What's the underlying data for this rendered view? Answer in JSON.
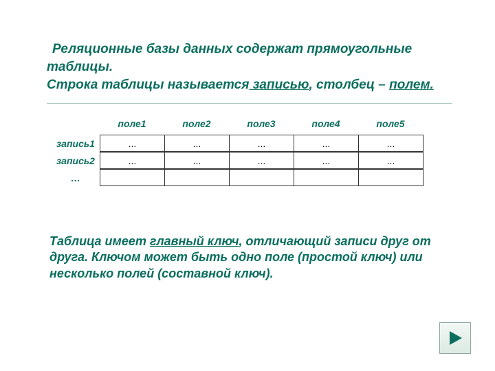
{
  "heading": {
    "line1_indent": "Реляционные базы данных содержат прямоугольные",
    "line2": "таблицы.",
    "line3_pre": "Строка таблицы называется",
    "line3_u1": " записью",
    "line3_mid": ", столбец – ",
    "line3_u2": "полем."
  },
  "table": {
    "cols": [
      "поле1",
      "поле2",
      "поле3",
      "поле4",
      "поле5"
    ],
    "rows": [
      "запись1",
      "запись2",
      "…"
    ],
    "cells": [
      [
        "...",
        "...",
        "...",
        "...",
        "..."
      ],
      [
        "...",
        "...",
        "...",
        "...",
        "..."
      ],
      [
        "",
        "",
        "",
        "",
        ""
      ]
    ]
  },
  "paragraph": {
    "pre": "Таблица имеет ",
    "u": "главный ключ",
    "rest": ", отличающий записи друг от друга. Ключом может быть одно поле (простой ключ) или несколько полей (составной ключ).",
    "full": "Таблица имеет главный ключ, отличающий записи друг от друга. Ключом может быть одно поле (простой ключ) или несколько полей (составной ключ)."
  },
  "nav": {
    "next_label": "next"
  }
}
